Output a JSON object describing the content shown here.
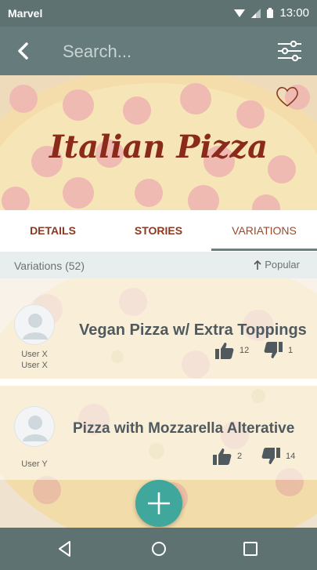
{
  "status_bar": {
    "carrier": "Marvel",
    "time": "13:00"
  },
  "app_bar": {
    "search_placeholder": "Search..."
  },
  "hero": {
    "title": "Italian Pizza"
  },
  "tabs": [
    {
      "label": "DETAILS"
    },
    {
      "label": "STORIES"
    },
    {
      "label": "VARIATIONS",
      "active": true
    }
  ],
  "variations": {
    "count_label": "Variations (52)",
    "sort_label": "Popular"
  },
  "items": [
    {
      "title": "Vegan Pizza w/ Extra Toppings",
      "user_line1": "User X",
      "user_line2": "User X",
      "upvotes": "12",
      "downvotes": "1"
    },
    {
      "title": "Pizza with Mozzarella Alterative",
      "user_line1": "User Y",
      "upvotes": "2",
      "downvotes": "14"
    }
  ],
  "colors": {
    "app_bar": "#667b7b",
    "status_bar": "#5f7272",
    "fab": "#3fa79b",
    "title": "#8a2a1a"
  }
}
